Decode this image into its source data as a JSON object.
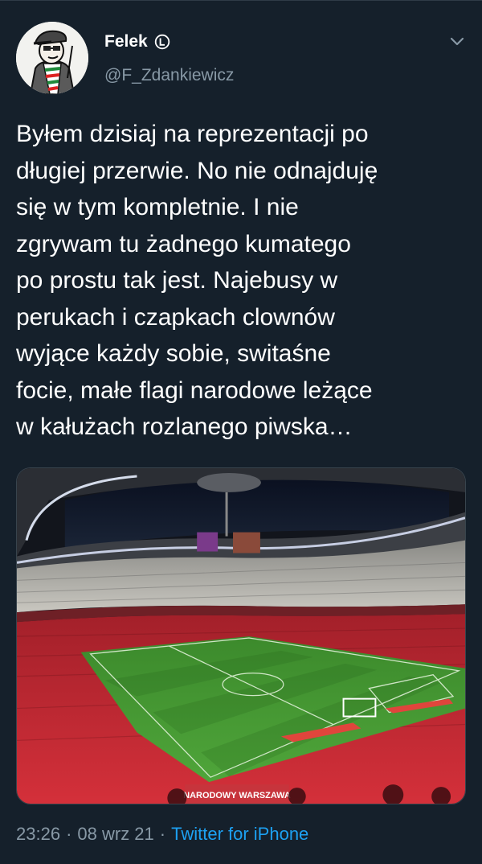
{
  "user": {
    "display_name": "Felek",
    "handle": "@F_Zdankiewicz"
  },
  "icons": {
    "verified": "circle-l-icon",
    "menu": "chevron-down-icon"
  },
  "tweet": {
    "text": "Byłem dzisiaj na reprezentacji po\ndługiej przerwie. No nie odnajduję\nsię w tym kompletnie. I nie\nzgrywam tu żadnego kumatego\npo prostu tak jest. Najebusy w\nperukach i czapkach clownów\nwyjące każdy sobie, switaśne\nfocie, małe flagi narodowe leżące\nw kałużach rozlanego piwska…"
  },
  "media": {
    "banner_text": "NARODOWY WARSZAWA"
  },
  "meta": {
    "time": "23:26",
    "separator_1": "·",
    "date": "08 wrz 21",
    "separator_2": "·",
    "source": "Twitter for iPhone"
  },
  "colors": {
    "background": "#15202b",
    "secondary_text": "#8899a6",
    "link": "#1da1f2"
  }
}
